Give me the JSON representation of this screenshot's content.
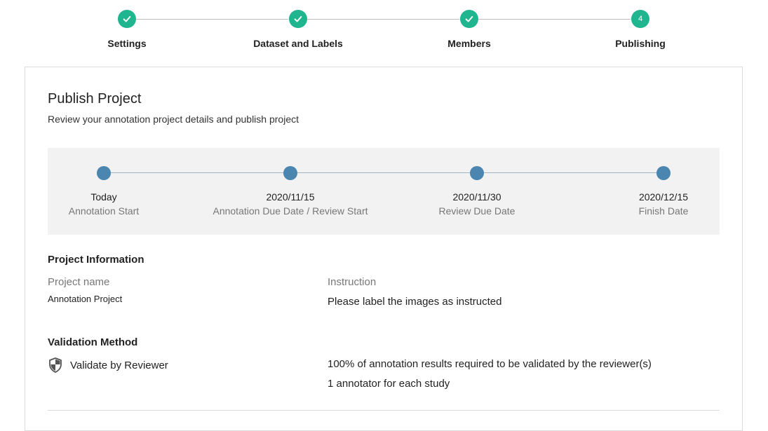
{
  "stepper": {
    "steps": [
      {
        "label": "Settings",
        "state": "complete"
      },
      {
        "label": "Dataset and Labels",
        "state": "complete"
      },
      {
        "label": "Members",
        "state": "complete"
      },
      {
        "label": "Publishing",
        "state": "current",
        "number": "4"
      }
    ],
    "accent_color": "#1fb58f"
  },
  "card": {
    "title": "Publish Project",
    "subtitle": "Review your annotation project details and publish project"
  },
  "timeline": {
    "points": [
      {
        "date": "Today",
        "label": "Annotation Start"
      },
      {
        "date": "2020/11/15",
        "label": "Annotation Due Date / Review Start"
      },
      {
        "date": "2020/11/30",
        "label": "Review Due Date"
      },
      {
        "date": "2020/12/15",
        "label": "Finish Date"
      }
    ],
    "dot_color": "#4a86b0"
  },
  "project_information": {
    "title": "Project Information",
    "name_label": "Project name",
    "name_value": "Annotation Project",
    "instruction_label": "Instruction",
    "instruction_value": "Please label the images as instructed"
  },
  "validation": {
    "title": "Validation Method",
    "method_icon": "shield-icon",
    "method": "Validate by Reviewer",
    "detail_1": "100% of annotation results required to be validated by the reviewer(s)",
    "detail_2": "1 annotator for each study"
  }
}
